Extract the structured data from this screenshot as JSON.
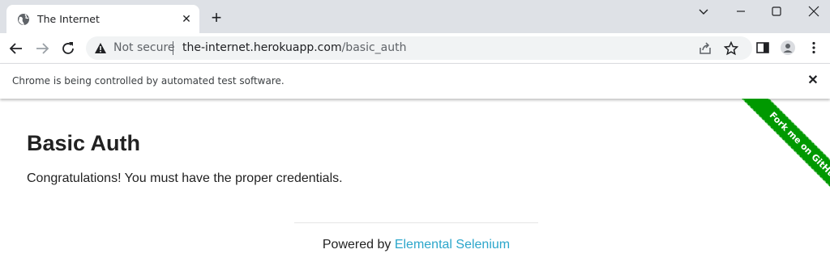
{
  "browser": {
    "tab_title": "The Internet",
    "tab_close": "✕",
    "new_tab": "+",
    "security_label": "Not secure",
    "url_host": "the-internet.herokuapp.com",
    "url_path": "/basic_auth",
    "infobar_text": "Chrome is being controlled by automated test software.",
    "infobar_close": "✕"
  },
  "page": {
    "title": "Basic Auth",
    "message": "Congratulations! You must have the proper credentials.",
    "ribbon": "Fork me on GitHub",
    "footer_prefix": "Powered by ",
    "footer_link": "Elemental Selenium"
  },
  "icons": {
    "favicon": "globe-icon",
    "back": "arrow-left-icon",
    "forward": "arrow-right-icon",
    "reload": "reload-icon",
    "warning": "warning-icon",
    "share": "share-icon",
    "bookmark": "star-icon",
    "side_panel": "side-panel-icon",
    "profile": "profile-icon",
    "menu": "kebab-menu-icon"
  },
  "colors": {
    "tabstrip": "#dee1e6",
    "omnibox": "#f1f3f4",
    "link": "#2ba6cb",
    "ribbon": "#009900"
  }
}
